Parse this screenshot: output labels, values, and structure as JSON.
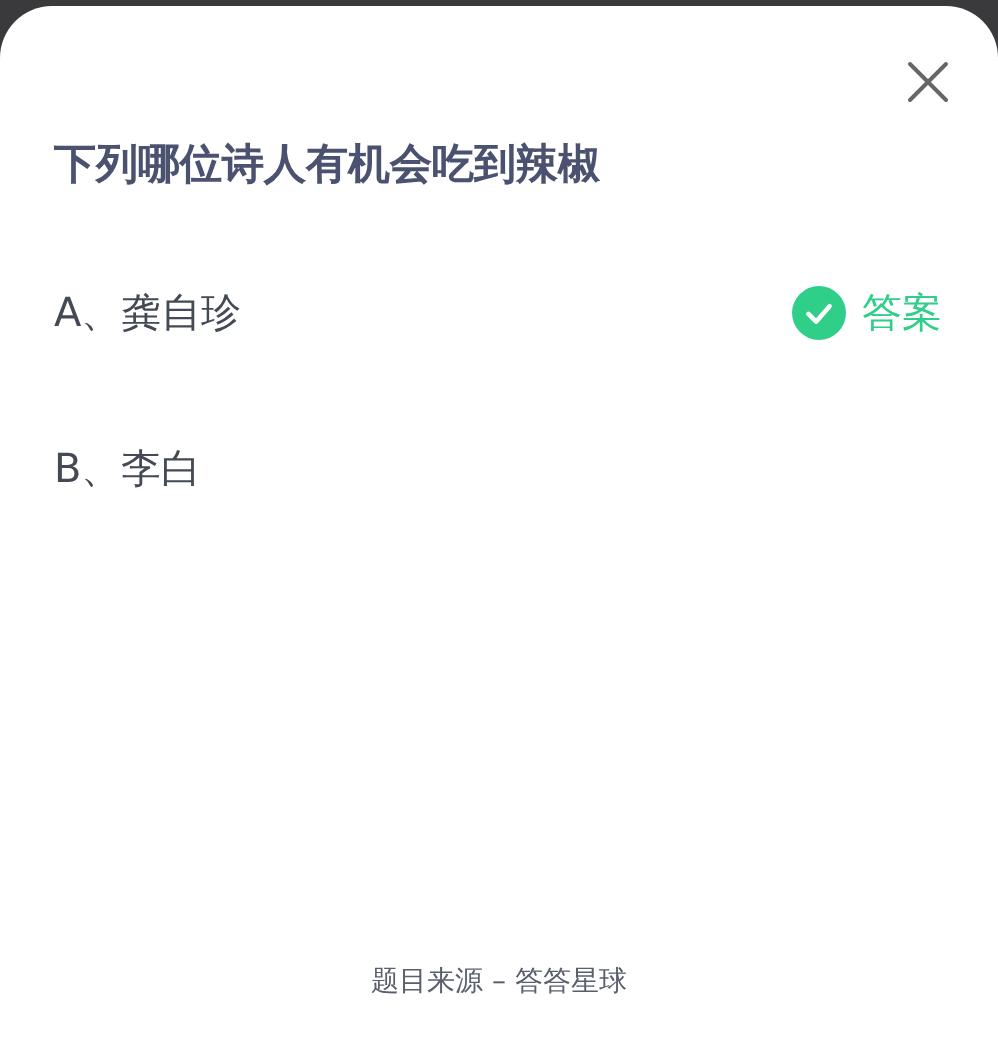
{
  "question": "下列哪位诗人有机会吃到辣椒",
  "options": [
    {
      "label": "A、龚自珍",
      "correct": true
    },
    {
      "label": "B、李白",
      "correct": false
    }
  ],
  "answer_label": "答案",
  "footer": "题目来源 – 答答星球"
}
